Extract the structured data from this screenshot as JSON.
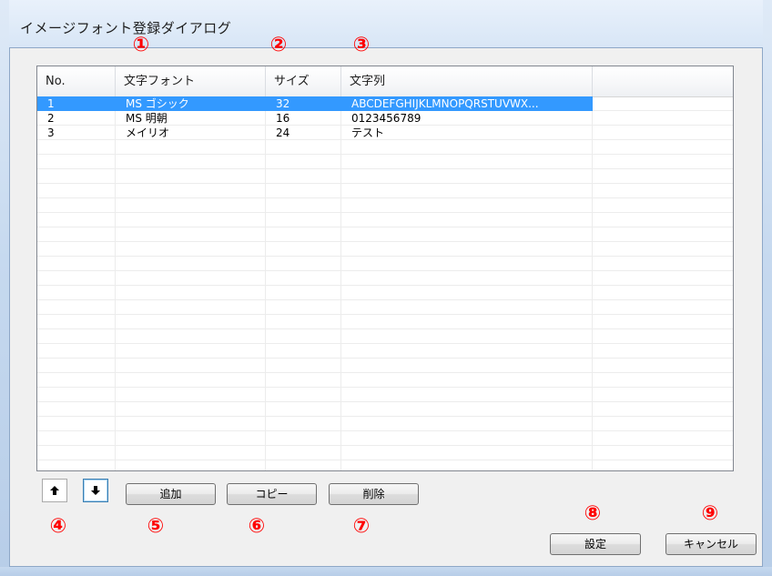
{
  "window": {
    "title": "イメージフォント登録ダイアログ"
  },
  "list": {
    "columns": [
      "No.",
      "文字フォント",
      "サイズ",
      "文字列"
    ],
    "rows": [
      {
        "no": "1",
        "font": "MS ゴシック",
        "size": "32",
        "text": "ABCDEFGHIJKLMNOPQRSTUVWX...",
        "selected": true
      },
      {
        "no": "2",
        "font": "MS 明朝",
        "size": "16",
        "text": "0123456789",
        "selected": false
      },
      {
        "no": "3",
        "font": "メイリオ",
        "size": "24",
        "text": "テスト",
        "selected": false
      }
    ]
  },
  "buttons": {
    "up_icon": "arrow-up-icon",
    "down_icon": "arrow-down-icon",
    "add": "追加",
    "copy": "コピー",
    "delete": "削除",
    "ok": "設定",
    "cancel": "キャンセル"
  },
  "annotations": {
    "n1": "①",
    "n2": "②",
    "n3": "③",
    "n4": "④",
    "n5": "⑤",
    "n6": "⑥",
    "n7": "⑦",
    "n8": "⑧",
    "n9": "⑨"
  },
  "colors": {
    "annotation": "#ff0000",
    "selection": "#3399ff"
  }
}
